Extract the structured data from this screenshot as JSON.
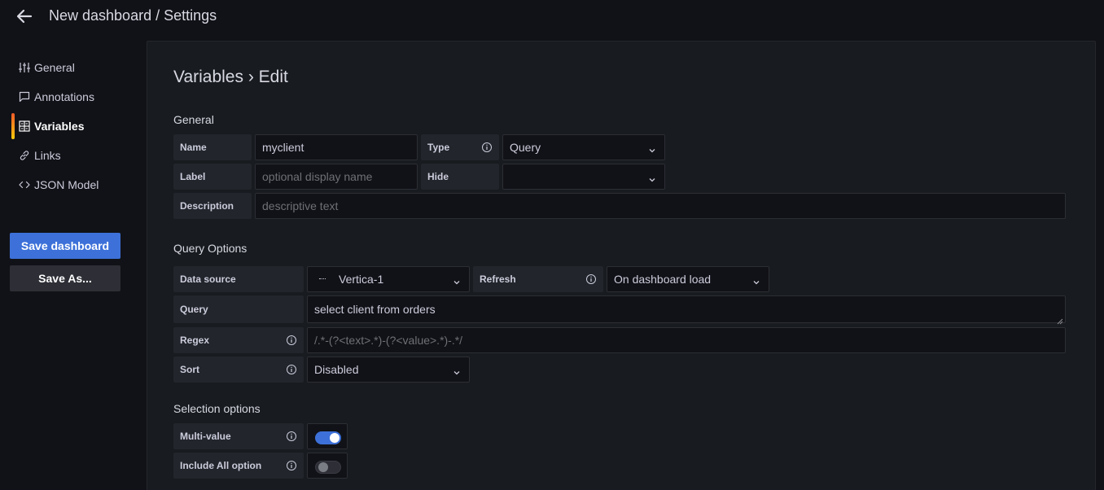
{
  "header": {
    "title": "New dashboard / Settings"
  },
  "sidebar": {
    "items": [
      {
        "label": "General",
        "icon": "sliders-icon"
      },
      {
        "label": "Annotations",
        "icon": "comment-icon"
      },
      {
        "label": "Variables",
        "icon": "calculator-icon",
        "active": true
      },
      {
        "label": "Links",
        "icon": "link-icon"
      },
      {
        "label": "JSON Model",
        "icon": "code-icon"
      }
    ],
    "save_label": "Save dashboard",
    "save_as_label": "Save As..."
  },
  "main": {
    "heading": "Variables › Edit",
    "general": {
      "title": "General",
      "name_label": "Name",
      "name_value": "myclient",
      "type_label": "Type",
      "type_value": "Query",
      "label_label": "Label",
      "label_placeholder": "optional display name",
      "hide_label": "Hide",
      "hide_value": "",
      "description_label": "Description",
      "description_placeholder": "descriptive text"
    },
    "query_options": {
      "title": "Query Options",
      "datasource_label": "Data source",
      "datasource_value": "Vertica-1",
      "refresh_label": "Refresh",
      "refresh_value": "On dashboard load",
      "query_label": "Query",
      "query_value": "select client from orders",
      "regex_label": "Regex",
      "regex_placeholder": "/.*-(?<text>.*)-(?<value>.*)-.*/",
      "sort_label": "Sort",
      "sort_value": "Disabled"
    },
    "selection_options": {
      "title": "Selection options",
      "multi_value_label": "Multi-value",
      "multi_value_on": true,
      "include_all_label": "Include All option",
      "include_all_on": false
    }
  },
  "colors": {
    "primary": "#3d71d9",
    "active_accent_start": "#f05a28",
    "active_accent_end": "#fbca0a"
  }
}
